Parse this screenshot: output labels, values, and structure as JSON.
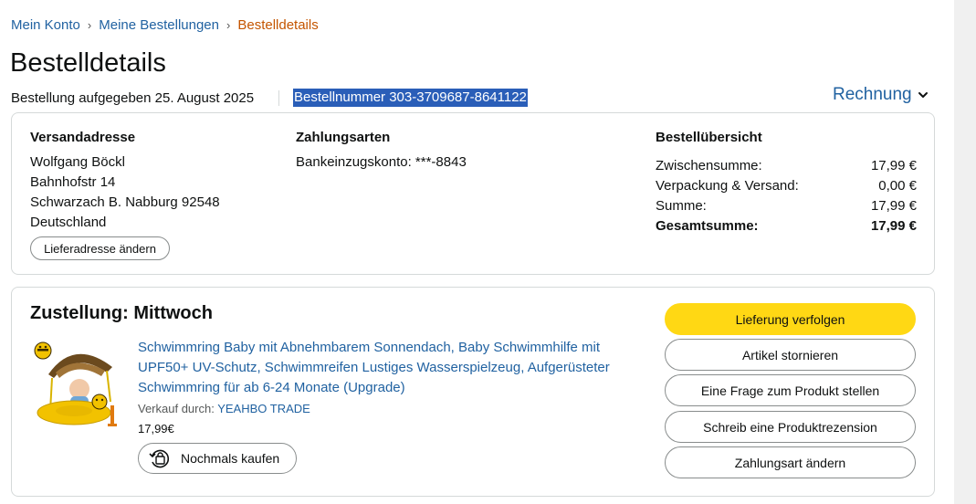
{
  "breadcrumb": {
    "items": [
      "Mein Konto",
      "Meine Bestellungen"
    ],
    "separator": "›",
    "current": "Bestelldetails"
  },
  "page": {
    "title": "Bestelldetails",
    "order_date": "Bestellung aufgegeben 25. August 2025",
    "order_number": "Bestellnummer 303-3709687-8641122",
    "invoice_label": "Rechnung"
  },
  "shipping": {
    "heading": "Versandadresse",
    "lines": [
      "Wolfgang Böckl",
      "Bahnhofstr 14",
      "Schwarzach B. Nabburg 92548",
      "Deutschland"
    ],
    "change_button": "Lieferadresse ändern"
  },
  "payment": {
    "heading": "Zahlungsarten",
    "method": "Bankeinzugskonto: ***-8843"
  },
  "summary": {
    "heading": "Bestellübersicht",
    "rows": [
      {
        "label": "Zwischensumme:",
        "value": "17,99 €"
      },
      {
        "label": "Verpackung & Versand:",
        "value": "0,00 €"
      },
      {
        "label": "Summe:",
        "value": "17,99 €"
      },
      {
        "label": "Gesamtsumme:",
        "value": "17,99 €"
      }
    ]
  },
  "delivery": {
    "title": "Zustellung: Mittwoch",
    "product_title": "Schwimmring Baby mit Abnehmbarem Sonnendach, Baby Schwimmhilfe mit UPF50+ UV-Schutz, Schwimmreifen Lustiges Wasserspielzeug, Aufgerüsteter Schwimmring für ab 6-24 Monate (Upgrade)",
    "seller_prefix": "Verkauf durch:",
    "seller_name": "YEAHBO TRADE",
    "price": "17,99€",
    "rebuy_label": "Nochmals kaufen",
    "actions": [
      "Lieferung verfolgen",
      "Artikel stornieren",
      "Eine Frage zum Produkt stellen",
      "Schreib eine Produktrezension",
      "Zahlungsart ändern"
    ]
  },
  "colors": {
    "link": "#2162a1",
    "breadcrumb_current": "#c45500",
    "primary_button": "#ffd814",
    "selection": "#2a5eb8",
    "border": "#d5d9d9"
  }
}
